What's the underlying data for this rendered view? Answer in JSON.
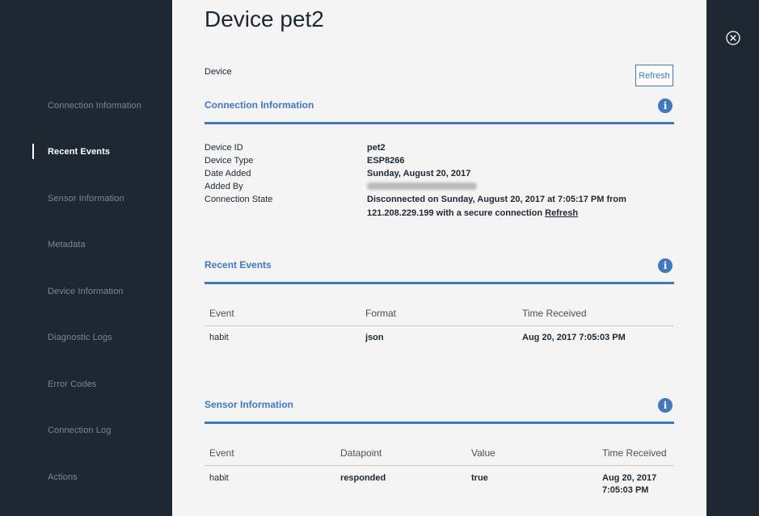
{
  "sidebar": {
    "items": [
      {
        "label": "Connection Information",
        "active": false
      },
      {
        "label": "Recent Events",
        "active": true
      },
      {
        "label": "Sensor Information",
        "active": false
      },
      {
        "label": "Metadata",
        "active": false
      },
      {
        "label": "Device Information",
        "active": false
      },
      {
        "label": "Diagnostic Logs",
        "active": false
      },
      {
        "label": "Error Codes",
        "active": false
      },
      {
        "label": "Connection Log",
        "active": false
      },
      {
        "label": "Actions",
        "active": false
      }
    ]
  },
  "header": {
    "title": "Device pet2",
    "subtitle": "Device",
    "refresh_label": "Refresh"
  },
  "connection": {
    "title": "Connection Information",
    "info_icon": "i",
    "device_id_label": "Device ID",
    "device_id": "pet2",
    "device_type_label": "Device Type",
    "device_type": "ESP8266",
    "date_added_label": "Date Added",
    "date_added": "Sunday, August 20, 2017",
    "added_by_label": "Added By",
    "state_label": "Connection State",
    "state_line1": "Disconnected on Sunday, August 20, 2017 at 7:05:17 PM from",
    "state_line2": "121.208.229.199 with a secure connection",
    "state_link": "Refresh"
  },
  "recent_events": {
    "title": "Recent Events",
    "info_icon": "i",
    "columns": [
      "Event",
      "Format",
      "Time Received"
    ],
    "rows": [
      {
        "event": "habit",
        "format": "json",
        "time": "Aug 20, 2017 7:05:03 PM"
      }
    ]
  },
  "sensor": {
    "title": "Sensor Information",
    "info_icon": "i",
    "columns": [
      "Event",
      "Datapoint",
      "Value",
      "Time Received"
    ],
    "rows": [
      {
        "event": "habit",
        "datapoint": "responded",
        "value": "true",
        "time_line1": "Aug 20, 2017",
        "time_line2": "7:05:03 PM"
      }
    ]
  },
  "colors": {
    "accent": "#4178be",
    "sidebar_bg": "#1d2832",
    "panel_bg": "#f4f4f4"
  },
  "icons": {
    "close": "close-icon",
    "info": "info-icon"
  }
}
